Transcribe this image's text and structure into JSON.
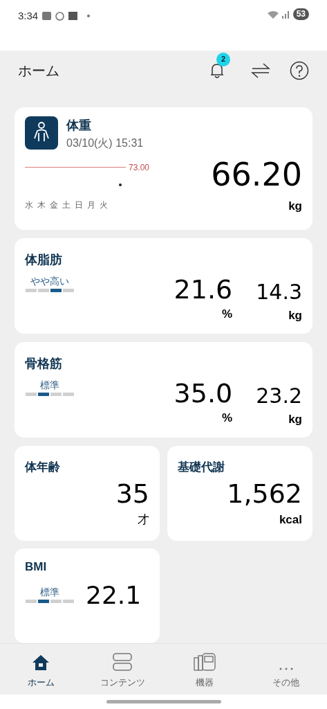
{
  "status_bar": {
    "time": "3:34",
    "battery": "53"
  },
  "header": {
    "title": "ホーム",
    "notification_count": "2"
  },
  "weight": {
    "title": "体重",
    "datetime": "03/10(火) 15:31",
    "target": "73.00",
    "days": [
      "水",
      "木",
      "金",
      "土",
      "日",
      "月",
      "火"
    ],
    "value": "66.20",
    "unit": "kg"
  },
  "metrics": [
    {
      "title": "体脂肪",
      "status": "やや高い",
      "segments": [
        {
          "selected": false
        },
        {
          "selected": false
        },
        {
          "selected": true
        },
        {
          "selected": false
        }
      ],
      "values": [
        {
          "value": "21.6",
          "unit": "%"
        },
        {
          "value": "14.3",
          "unit": "kg"
        }
      ]
    },
    {
      "title": "骨格筋",
      "status": "標準",
      "segments": [
        {
          "selected": false
        },
        {
          "selected": true
        },
        {
          "selected": false
        },
        {
          "selected": false
        }
      ],
      "values": [
        {
          "value": "35.0",
          "unit": "%"
        },
        {
          "value": "23.2",
          "unit": "kg"
        }
      ]
    }
  ],
  "small_cards": [
    {
      "title": "体年齢",
      "value": "35",
      "unit": "才"
    },
    {
      "title": "基礎代謝",
      "value": "1,562",
      "unit": "kcal"
    }
  ],
  "bmi": {
    "title": "BMI",
    "status": "標準",
    "segments": [
      {
        "selected": false
      },
      {
        "selected": true
      },
      {
        "selected": false
      },
      {
        "selected": false
      }
    ],
    "value": "22.1"
  },
  "nav": [
    {
      "label": "ホーム",
      "kind": "home",
      "selected": true
    },
    {
      "label": "コンテンツ",
      "kind": "contents",
      "selected": false
    },
    {
      "label": "機器",
      "kind": "devices",
      "selected": false
    },
    {
      "label": "その他",
      "kind": "more",
      "selected": false
    }
  ]
}
